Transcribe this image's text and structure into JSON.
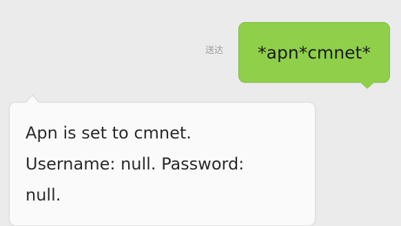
{
  "conversation": {
    "outgoing": {
      "status": "送达",
      "text": "*apn*cmnet*"
    },
    "incoming": {
      "lines": [
        "Apn is set to cmnet.",
        "Username: null. Password:",
        "null."
      ]
    }
  }
}
